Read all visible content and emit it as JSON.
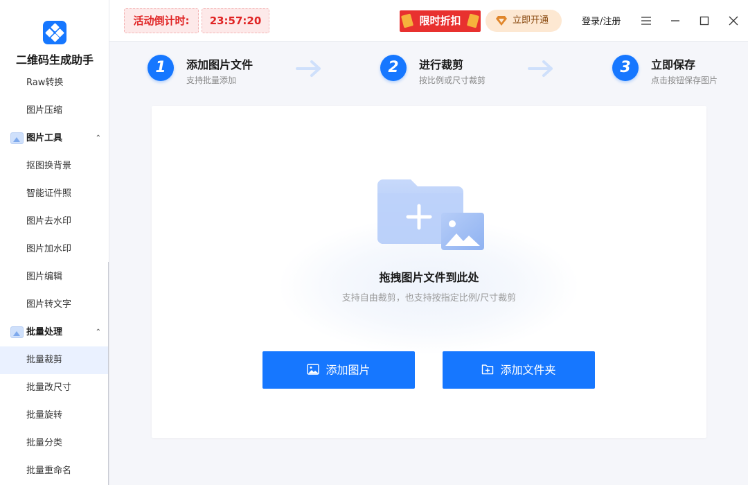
{
  "app": {
    "name": "二维码生成助手"
  },
  "sidebar": {
    "items_top": [
      {
        "label": "Raw转换"
      },
      {
        "label": "图片压缩"
      }
    ],
    "groups": [
      {
        "label": "图片工具",
        "caret": "^",
        "items": [
          {
            "label": "抠图换背景"
          },
          {
            "label": "智能证件照"
          },
          {
            "label": "图片去水印"
          },
          {
            "label": "图片加水印"
          },
          {
            "label": "图片编辑"
          },
          {
            "label": "图片转文字"
          }
        ]
      },
      {
        "label": "批量处理",
        "caret": "^",
        "items": [
          {
            "label": "批量裁剪",
            "active": true
          },
          {
            "label": "批量改尺寸"
          },
          {
            "label": "批量旋转"
          },
          {
            "label": "批量分类"
          },
          {
            "label": "批量重命名"
          }
        ]
      }
    ]
  },
  "topbar": {
    "countdown_label": "活动倒计时:",
    "countdown_value": "23:57:20",
    "promo_label": "限时折扣",
    "vip_label": "立即开通",
    "login_label": "登录/注册"
  },
  "steps": [
    {
      "number": "1",
      "title": "添加图片文件",
      "subtitle": "支持批量添加"
    },
    {
      "number": "2",
      "title": "进行裁剪",
      "subtitle": "按比例或尺寸裁剪"
    },
    {
      "number": "3",
      "title": "立即保存",
      "subtitle": "点击按钮保存图片"
    }
  ],
  "dropzone": {
    "title": "拖拽图片文件到此处",
    "subtitle": "支持自由裁剪，也支持按指定比例/尺寸裁剪",
    "add_image_label": "添加图片",
    "add_folder_label": "添加文件夹"
  },
  "colors": {
    "accent": "#1677ff",
    "countdown_red": "#e02424",
    "promo_red": "#e8312f",
    "vip_bg": "#fde8d2"
  }
}
